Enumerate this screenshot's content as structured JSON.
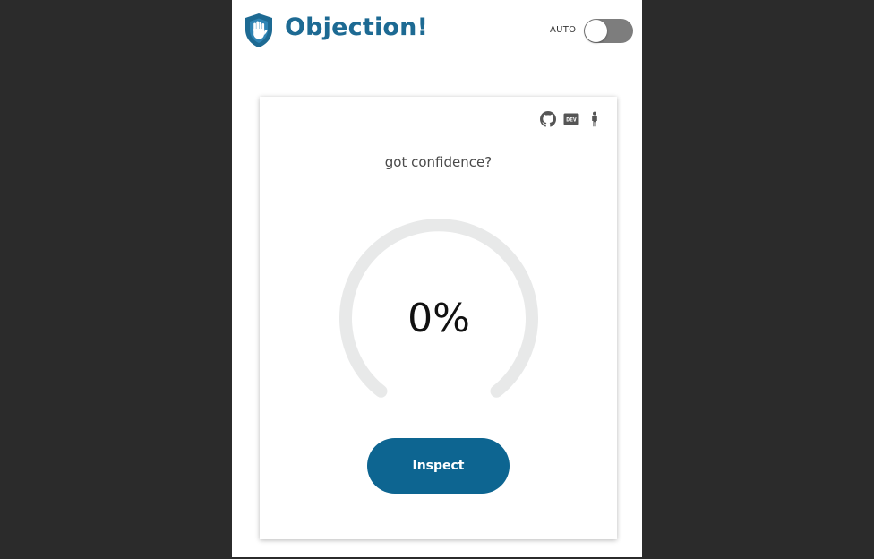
{
  "header": {
    "title": "Objection!",
    "auto_label": "AUTO",
    "auto_enabled": false
  },
  "card": {
    "icons": [
      "github-icon",
      "dev-icon",
      "accessibility-person-icon"
    ],
    "dev_icon_text": "DEV",
    "subtitle": "got confidence?",
    "gauge": {
      "value_text": "0%",
      "value_percent": 0
    },
    "inspect_label": "Inspect"
  },
  "colors": {
    "brand": "#1d6a93",
    "button": "#0d6591",
    "toggle_off": "#7d7d7d",
    "gauge_track": "#e8e9e9",
    "background": "#2b2b2b"
  }
}
